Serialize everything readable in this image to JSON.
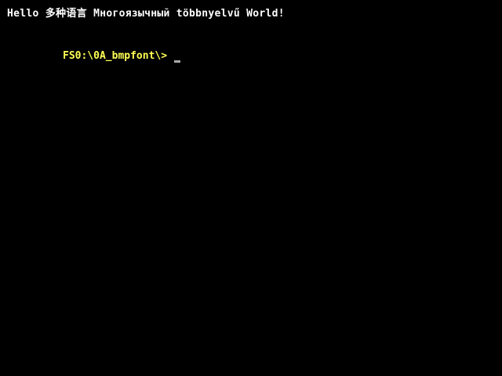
{
  "screen": {
    "banner_text": "Hello 多种语言 Многоязычный többnyelvű World!",
    "prompt_text": "FS0:\\0A_bmpfont\\>",
    "colors": {
      "background": "#000000",
      "banner": "#ffffff",
      "prompt": "#ffff55",
      "cursor": "#aaaaaa"
    }
  }
}
